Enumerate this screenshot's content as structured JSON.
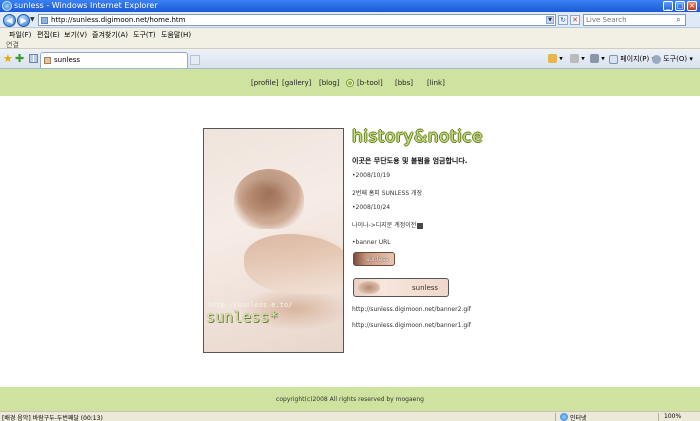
{
  "window": {
    "title": "sunless - Windows Internet Explorer"
  },
  "address": {
    "url": "http://sunless.digimoon.net/home.htm",
    "search_placeholder": "Live Search"
  },
  "menu": {
    "items": [
      "파일(F)",
      "편집(E)",
      "보기(V)",
      "즐겨찾기(A)",
      "도구(T)",
      "도움말(H)"
    ]
  },
  "links_bar": {
    "label": "연결"
  },
  "tab": {
    "label": "sunless"
  },
  "commands": {
    "page": "페이지(P)",
    "tools": "도구(O)"
  },
  "site_nav": {
    "profile": "[profile]",
    "gallery": "[gallery]",
    "blog": "[blog]",
    "btool": "[b-tool]",
    "bbs": "[bbs]",
    "link": "[link]"
  },
  "portrait": {
    "url_text": "http://sunless.e.to/",
    "brand": "sunless*"
  },
  "content": {
    "heading": "history&notice",
    "notice": "이곳은 무단도용 및 불펌을 엄금합니다.",
    "date1": "•2008/10/19",
    "entry1": "2번째 홈피 SUNLESS 개장",
    "date2": "•2008/10/24",
    "entry2": "나이나->디지문 계정이전",
    "banner_url_label": "•banner URL",
    "banner1_text": "sunless",
    "banner2_text": "sunless",
    "banner2_url": "http://sunless.digimoon.net/banner2.gif",
    "banner1_url": "http://sunless.digimoon.net/banner1.gif"
  },
  "footer": {
    "copyright": "copyright(c)2008 All rights reserved by mogaeng"
  },
  "status": {
    "text": "[배경 음악] 바람구두-두번째달 (00:13)",
    "zone": "인터넷",
    "zoom": "100%"
  }
}
